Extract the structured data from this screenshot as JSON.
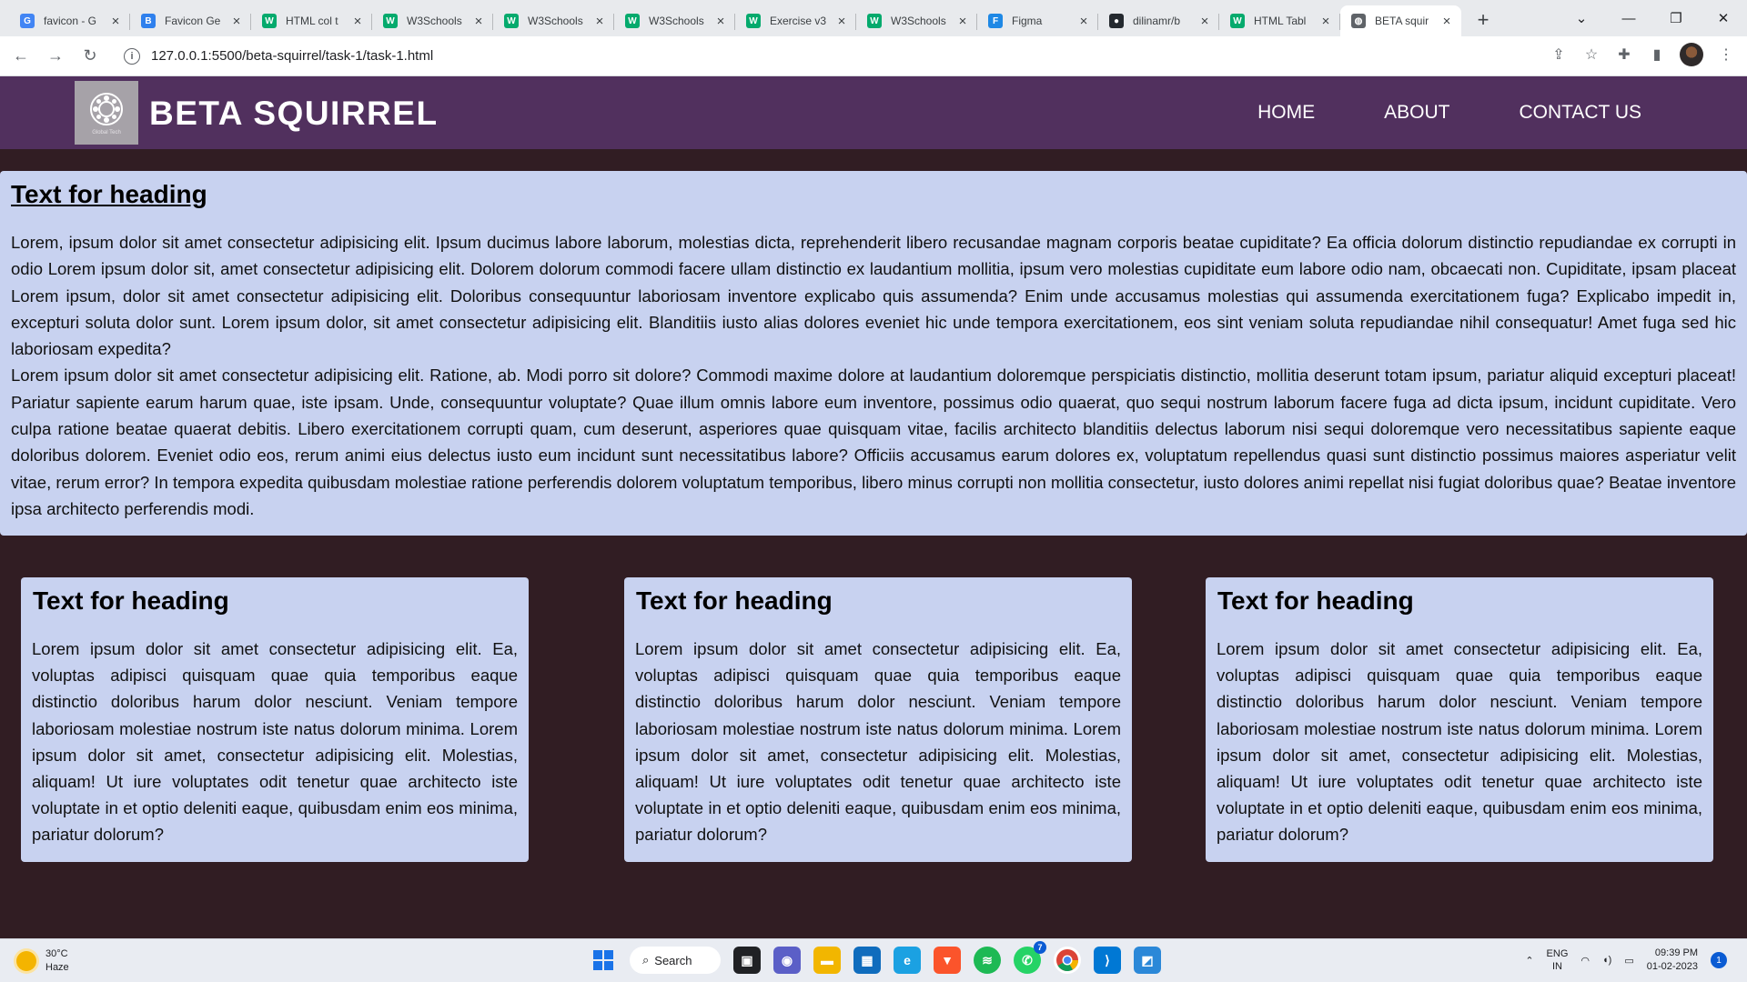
{
  "browser": {
    "tabs": [
      {
        "title": "favicon - G",
        "icon": "google-icon",
        "color": "#4285f4",
        "glyph": "G"
      },
      {
        "title": "Favicon Ge",
        "icon": "favicon-generator-icon",
        "color": "#2f80ed",
        "glyph": "B"
      },
      {
        "title": "HTML col t",
        "icon": "w3schools-icon",
        "color": "#04aa6d",
        "glyph": "W"
      },
      {
        "title": "W3Schools",
        "icon": "w3schools-icon",
        "color": "#04aa6d",
        "glyph": "W"
      },
      {
        "title": "W3Schools",
        "icon": "w3schools-icon",
        "color": "#04aa6d",
        "glyph": "W"
      },
      {
        "title": "W3Schools",
        "icon": "w3schools-icon",
        "color": "#04aa6d",
        "glyph": "W"
      },
      {
        "title": "Exercise v3",
        "icon": "w3schools-icon",
        "color": "#04aa6d",
        "glyph": "W"
      },
      {
        "title": "W3Schools",
        "icon": "w3schools-icon",
        "color": "#04aa6d",
        "glyph": "W"
      },
      {
        "title": "Figma",
        "icon": "figma-icon",
        "color": "#1e88e5",
        "glyph": "F"
      },
      {
        "title": "dilinamr/b",
        "icon": "github-icon",
        "color": "#24292f",
        "glyph": "●"
      },
      {
        "title": "HTML Tabl",
        "icon": "w3schools-icon",
        "color": "#04aa6d",
        "glyph": "W"
      },
      {
        "title": "BETA squir",
        "icon": "globe-icon",
        "color": "#5f6368",
        "glyph": "◍",
        "active": true
      }
    ],
    "new_tab": "+",
    "url": "127.0.0.1:5500/beta-squirrel/task-1/task-1.html"
  },
  "site": {
    "brand": "BETA SQUIRREL",
    "logo_caption": "Global Tech",
    "nav": [
      "HOME",
      "ABOUT",
      "CONTACT US"
    ],
    "main": {
      "heading": "Text for heading",
      "paragraphs": [
        "Lorem, ipsum dolor sit amet consectetur adipisicing elit. Ipsum ducimus labore laborum, molestias dicta, reprehenderit libero recusandae magnam corporis beatae cupiditate? Ea officia dolorum distinctio repudiandae ex corrupti in odio Lorem ipsum dolor sit, amet consectetur adipisicing elit. Dolorem dolorum commodi facere ullam distinctio ex laudantium mollitia, ipsum vero molestias cupiditate eum labore odio nam, obcaecati non. Cupiditate, ipsam placeat Lorem ipsum, dolor sit amet consectetur adipisicing elit. Doloribus consequuntur laboriosam inventore explicabo quis assumenda? Enim unde accusamus molestias qui assumenda exercitationem fuga? Explicabo impedit in, excepturi soluta dolor sunt. Lorem ipsum dolor, sit amet consectetur adipisicing elit. Blanditiis iusto alias dolores eveniet hic unde tempora exercitationem, eos sint veniam soluta repudiandae nihil consequatur! Amet fuga sed hic laboriosam expedita?",
        "Lorem ipsum dolor sit amet consectetur adipisicing elit. Ratione, ab. Modi porro sit dolore? Commodi maxime dolore at laudantium doloremque perspiciatis distinctio, mollitia deserunt totam ipsum, pariatur aliquid excepturi placeat! Pariatur sapiente earum harum quae, iste ipsam. Unde, consequuntur voluptate? Quae illum omnis labore eum inventore, possimus odio quaerat, quo sequi nostrum laborum facere fuga ad dicta ipsum, incidunt cupiditate. Vero culpa ratione beatae quaerat debitis. Libero exercitationem corrupti quam, cum deserunt, asperiores quae quisquam vitae, facilis architecto blanditiis delectus laborum nisi sequi doloremque vero necessitatibus sapiente eaque doloribus dolorem. Eveniet odio eos, rerum animi eius delectus iusto eum incidunt sunt necessitatibus labore? Officiis accusamus earum dolores ex, voluptatum repellendus quasi sunt distinctio possimus maiores asperiatur velit vitae, rerum error? In tempora expedita quibusdam molestiae ratione perferendis dolorem voluptatum temporibus, libero minus corrupti non mollitia consectetur, iusto dolores animi repellat nisi fugiat doloribus quae? Beatae inventore ipsa architecto perferendis modi."
      ]
    },
    "cards": [
      {
        "heading": "Text for heading",
        "text": "Lorem ipsum dolor sit amet consectetur adipisicing elit. Ea, voluptas adipisci quisquam quae quia temporibus eaque distinctio doloribus harum dolor nesciunt. Veniam tempore laboriosam molestiae nostrum iste natus dolorum minima. Lorem ipsum dolor sit amet, consectetur adipisicing elit. Molestias, aliquam! Ut iure voluptates odit tenetur quae architecto iste voluptate in et optio deleniti eaque, quibusdam enim eos minima, pariatur dolorum?"
      },
      {
        "heading": "Text for heading",
        "text": "Lorem ipsum dolor sit amet consectetur adipisicing elit. Ea, voluptas adipisci quisquam quae quia temporibus eaque distinctio doloribus harum dolor nesciunt. Veniam tempore laboriosam molestiae nostrum iste natus dolorum minima. Lorem ipsum dolor sit amet, consectetur adipisicing elit. Molestias, aliquam! Ut iure voluptates odit tenetur quae architecto iste voluptate in et optio deleniti eaque, quibusdam enim eos minima, pariatur dolorum?"
      },
      {
        "heading": "Text for heading",
        "text": "Lorem ipsum dolor sit amet consectetur adipisicing elit. Ea, voluptas adipisci quisquam quae quia temporibus eaque distinctio doloribus harum dolor nesciunt. Veniam tempore laboriosam molestiae nostrum iste natus dolorum minima. Lorem ipsum dolor sit amet, consectetur adipisicing elit. Molestias, aliquam! Ut iure voluptates odit tenetur quae architecto iste voluptate in et optio deleniti eaque, quibusdam enim eos minima, pariatur dolorum?"
      }
    ]
  },
  "taskbar": {
    "temperature": "30°C",
    "condition": "Haze",
    "search_label": "Search",
    "language_top": "ENG",
    "language_bottom": "IN",
    "time": "09:39 PM",
    "date": "01-02-2023",
    "notification_count": "1",
    "whatsapp_badge": "7"
  },
  "colors": {
    "header": "#51305e",
    "page_background": "#311d23",
    "panel": "#c8d2f0"
  }
}
